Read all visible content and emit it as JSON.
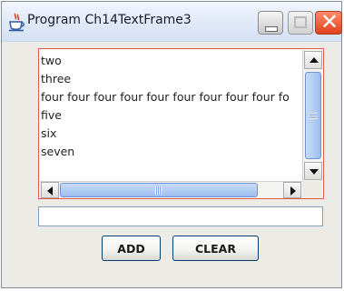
{
  "window": {
    "title": "Program Ch14TextFrame3",
    "controls": {
      "minimize": "minimize",
      "maximize": "maximize",
      "close": "✕"
    }
  },
  "textarea": {
    "lines": [
      "two",
      "three",
      "four four four four four four four four four fo",
      "five",
      "six",
      "seven"
    ]
  },
  "input": {
    "value": ""
  },
  "buttons": {
    "add": "ADD",
    "clear": "CLEAR"
  },
  "colors": {
    "scrollpane_border": "#e05a45",
    "close_button": "#e0411c",
    "scrollbar_thumb": "#9dbdf0"
  }
}
